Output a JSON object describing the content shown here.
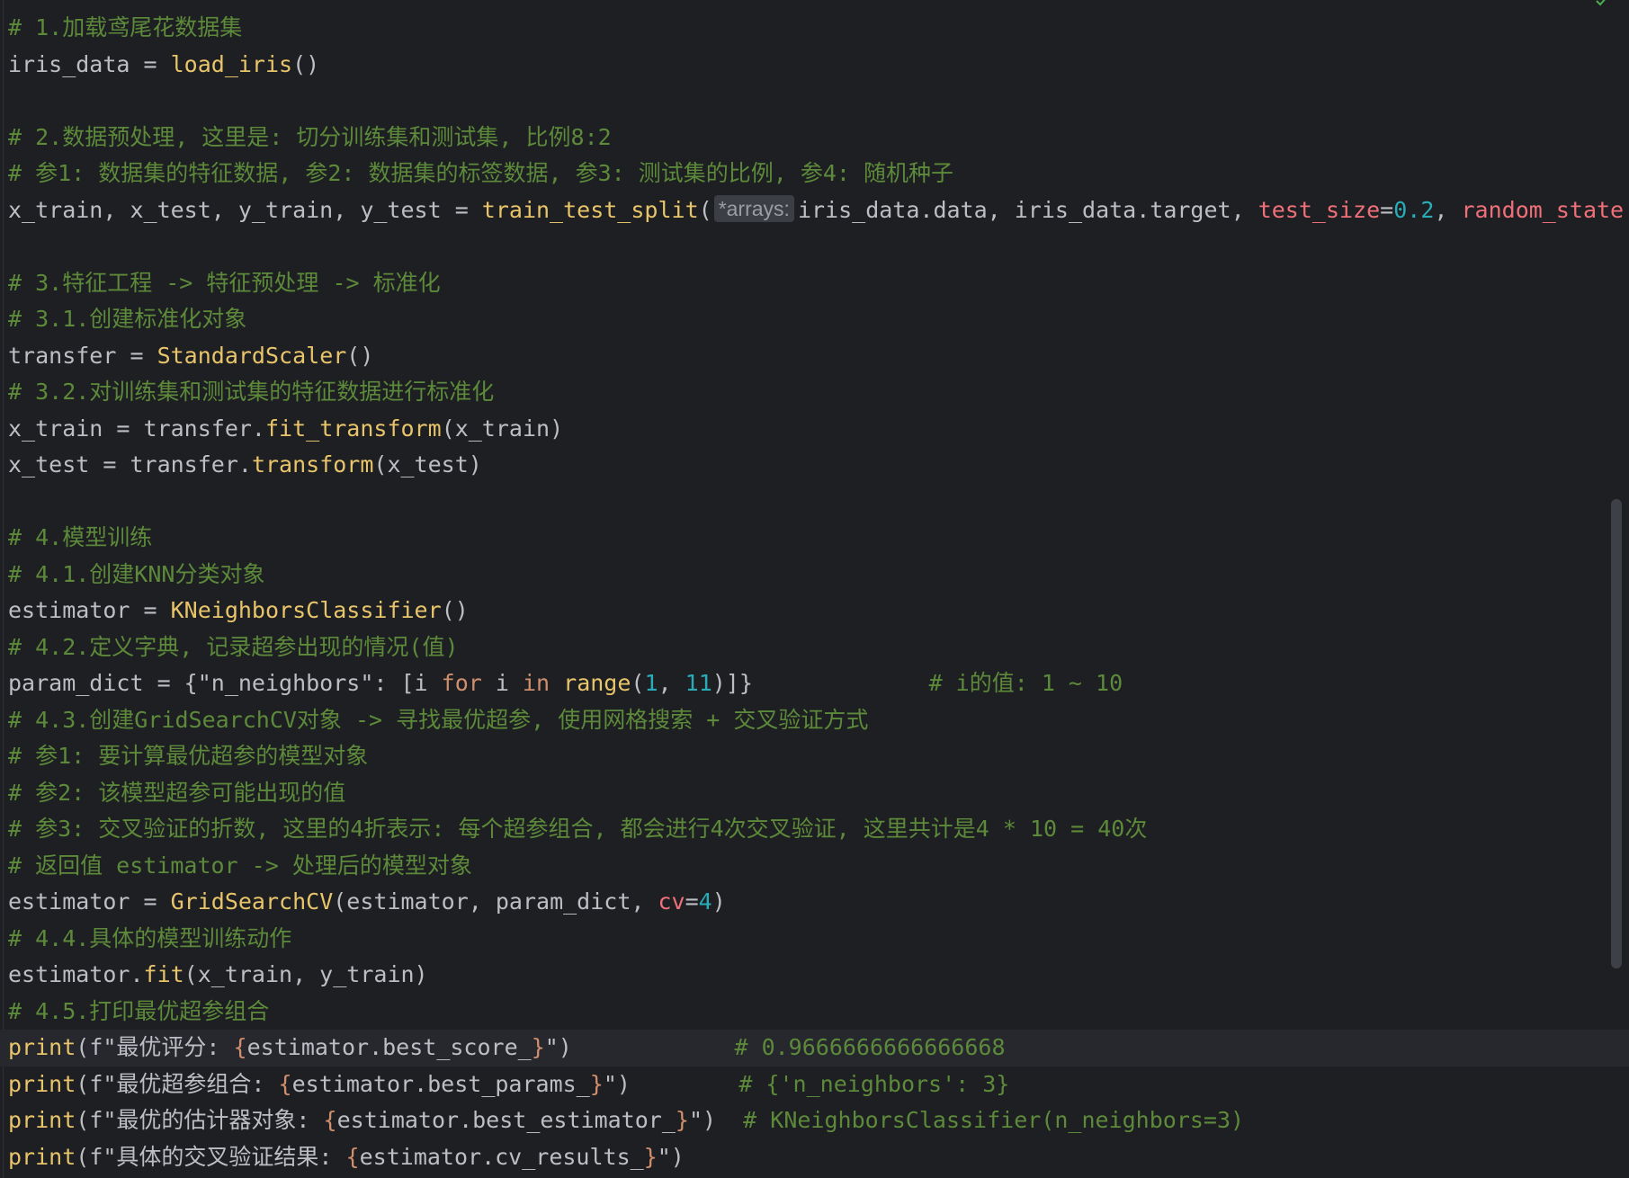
{
  "editor": {
    "lines": [
      {
        "segments": [
          {
            "t": "# 1.加载鸢尾花数据集",
            "c": "com"
          }
        ]
      },
      {
        "segments": [
          {
            "t": "iris_data = ",
            "c": ""
          },
          {
            "t": "load_iris",
            "c": "call"
          },
          {
            "t": "()",
            "c": ""
          }
        ]
      },
      {
        "segments": []
      },
      {
        "segments": [
          {
            "t": "# 2.数据预处理, 这里是: 切分训练集和测试集, 比例8:2",
            "c": "com"
          }
        ]
      },
      {
        "segments": [
          {
            "t": "# 参1: 数据集的特征数据, 参2: 数据集的标签数据, 参3: 测试集的比例, 参4: 随机种子",
            "c": "com"
          }
        ]
      },
      {
        "segments": [
          {
            "t": "x_train, x_test, y_train, y_test = ",
            "c": ""
          },
          {
            "t": "train_test_split",
            "c": "call"
          },
          {
            "t": "(",
            "c": ""
          },
          {
            "t": "*arrays:",
            "c": "hint"
          },
          {
            "t": "iris_data.data, iris_data.target, ",
            "c": ""
          },
          {
            "t": "test_size",
            "c": "kwarg"
          },
          {
            "t": "=",
            "c": ""
          },
          {
            "t": "0.2",
            "c": "num"
          },
          {
            "t": ", ",
            "c": ""
          },
          {
            "t": "random_state",
            "c": "kwarg"
          }
        ]
      },
      {
        "segments": []
      },
      {
        "segments": [
          {
            "t": "# 3.特征工程 -> 特征预处理 -> 标准化",
            "c": "com"
          }
        ]
      },
      {
        "segments": [
          {
            "t": "# 3.1.创建标准化对象",
            "c": "com"
          }
        ]
      },
      {
        "segments": [
          {
            "t": "transfer = ",
            "c": ""
          },
          {
            "t": "StandardScaler",
            "c": "call"
          },
          {
            "t": "()",
            "c": ""
          }
        ]
      },
      {
        "segments": [
          {
            "t": "# 3.2.对训练集和测试集的特征数据进行标准化",
            "c": "com"
          }
        ]
      },
      {
        "segments": [
          {
            "t": "x_train = transfer.",
            "c": ""
          },
          {
            "t": "fit_transform",
            "c": "call"
          },
          {
            "t": "(x_train)",
            "c": ""
          }
        ]
      },
      {
        "segments": [
          {
            "t": "x_test = transfer.",
            "c": ""
          },
          {
            "t": "transform",
            "c": "call"
          },
          {
            "t": "(x_test)",
            "c": ""
          }
        ]
      },
      {
        "segments": []
      },
      {
        "segments": [
          {
            "t": "# 4.模型训练",
            "c": "com"
          }
        ]
      },
      {
        "segments": [
          {
            "t": "# 4.1.创建KNN分类对象",
            "c": "com"
          }
        ]
      },
      {
        "segments": [
          {
            "t": "estimator = ",
            "c": ""
          },
          {
            "t": "KNeighborsClassifier",
            "c": "call"
          },
          {
            "t": "()",
            "c": ""
          }
        ]
      },
      {
        "segments": [
          {
            "t": "# 4.2.定义字典, 记录超参出现的情况(值)",
            "c": "com"
          }
        ]
      },
      {
        "segments": [
          {
            "t": "param_dict = {",
            "c": ""
          },
          {
            "t": "\"n_neighbors\"",
            "c": ""
          },
          {
            "t": ": [i ",
            "c": ""
          },
          {
            "t": "for",
            "c": "kw"
          },
          {
            "t": " i ",
            "c": ""
          },
          {
            "t": "in",
            "c": "kw"
          },
          {
            "t": " ",
            "c": ""
          },
          {
            "t": "range",
            "c": "builtin"
          },
          {
            "t": "(",
            "c": ""
          },
          {
            "t": "1",
            "c": "num"
          },
          {
            "t": ", ",
            "c": ""
          },
          {
            "t": "11",
            "c": "num"
          },
          {
            "t": ")]}",
            "c": ""
          },
          {
            "t": "             # i的值: 1 ~ 10",
            "c": "com"
          }
        ]
      },
      {
        "segments": [
          {
            "t": "# 4.3.创建GridSearchCV对象 -> 寻找最优超参, 使用网格搜索 + 交叉验证方式",
            "c": "com"
          }
        ]
      },
      {
        "segments": [
          {
            "t": "# 参1: 要计算最优超参的模型对象",
            "c": "com"
          }
        ]
      },
      {
        "segments": [
          {
            "t": "# 参2: 该模型超参可能出现的值",
            "c": "com"
          }
        ]
      },
      {
        "segments": [
          {
            "t": "# 参3: 交叉验证的折数, 这里的4折表示: 每个超参组合, 都会进行4次交叉验证, 这里共计是4 * 10 = 40次",
            "c": "com"
          }
        ]
      },
      {
        "segments": [
          {
            "t": "# 返回值 estimator -> 处理后的模型对象",
            "c": "com"
          }
        ]
      },
      {
        "segments": [
          {
            "t": "estimator = ",
            "c": ""
          },
          {
            "t": "GridSearchCV",
            "c": "call"
          },
          {
            "t": "(estimator, param_dict, ",
            "c": ""
          },
          {
            "t": "cv",
            "c": "kwarg"
          },
          {
            "t": "=",
            "c": ""
          },
          {
            "t": "4",
            "c": "num"
          },
          {
            "t": ")",
            "c": ""
          }
        ]
      },
      {
        "segments": [
          {
            "t": "# 4.4.具体的模型训练动作",
            "c": "com"
          }
        ]
      },
      {
        "segments": [
          {
            "t": "estimator.",
            "c": ""
          },
          {
            "t": "fit",
            "c": "call"
          },
          {
            "t": "(x_train, y_train)",
            "c": ""
          }
        ]
      },
      {
        "segments": [
          {
            "t": "# 4.5.打印最优超参组合",
            "c": "com"
          }
        ]
      },
      {
        "caret": true,
        "segments": [
          {
            "t": "print",
            "c": "builtin"
          },
          {
            "t": "(",
            "c": ""
          },
          {
            "t": "f\"最优评分: ",
            "c": ""
          },
          {
            "t": "{",
            "c": "brace"
          },
          {
            "t": "estimator.best_score_",
            "c": ""
          },
          {
            "t": "}",
            "c": "brace"
          },
          {
            "t": "\")",
            "c": ""
          },
          {
            "t": "            # 0.9666666666666668",
            "c": "com"
          }
        ]
      },
      {
        "segments": [
          {
            "t": "print",
            "c": "builtin"
          },
          {
            "t": "(",
            "c": ""
          },
          {
            "t": "f\"最优超参组合: ",
            "c": ""
          },
          {
            "t": "{",
            "c": "brace"
          },
          {
            "t": "estimator.best_params_",
            "c": ""
          },
          {
            "t": "}",
            "c": "brace"
          },
          {
            "t": "\")",
            "c": ""
          },
          {
            "t": "        # {'n_neighbors': 3}",
            "c": "com"
          }
        ]
      },
      {
        "segments": [
          {
            "t": "print",
            "c": "builtin"
          },
          {
            "t": "(",
            "c": ""
          },
          {
            "t": "f\"最优的估计器对象: ",
            "c": ""
          },
          {
            "t": "{",
            "c": "brace"
          },
          {
            "t": "estimator.best_estimator_",
            "c": ""
          },
          {
            "t": "}",
            "c": "brace"
          },
          {
            "t": "\")",
            "c": ""
          },
          {
            "t": "  # KNeighborsClassifier(n_neighbors=3)",
            "c": "com"
          }
        ]
      },
      {
        "segments": [
          {
            "t": "print",
            "c": "builtin"
          },
          {
            "t": "(",
            "c": ""
          },
          {
            "t": "f\"具体的交叉验证结果: ",
            "c": ""
          },
          {
            "t": "{",
            "c": "brace"
          },
          {
            "t": "estimator.cv_results_",
            "c": ""
          },
          {
            "t": "}",
            "c": "brace"
          },
          {
            "t": "\")",
            "c": ""
          }
        ]
      }
    ]
  },
  "icons": {
    "status": "check-icon"
  },
  "colors": {
    "background": "#1e1f22",
    "comment": "#5c8a3a",
    "function_call": "#e8c46a",
    "keyword": "#cf8e6d",
    "number": "#2aacb8",
    "keyword_argument": "#f0707a",
    "default_text": "#bcbec4"
  }
}
